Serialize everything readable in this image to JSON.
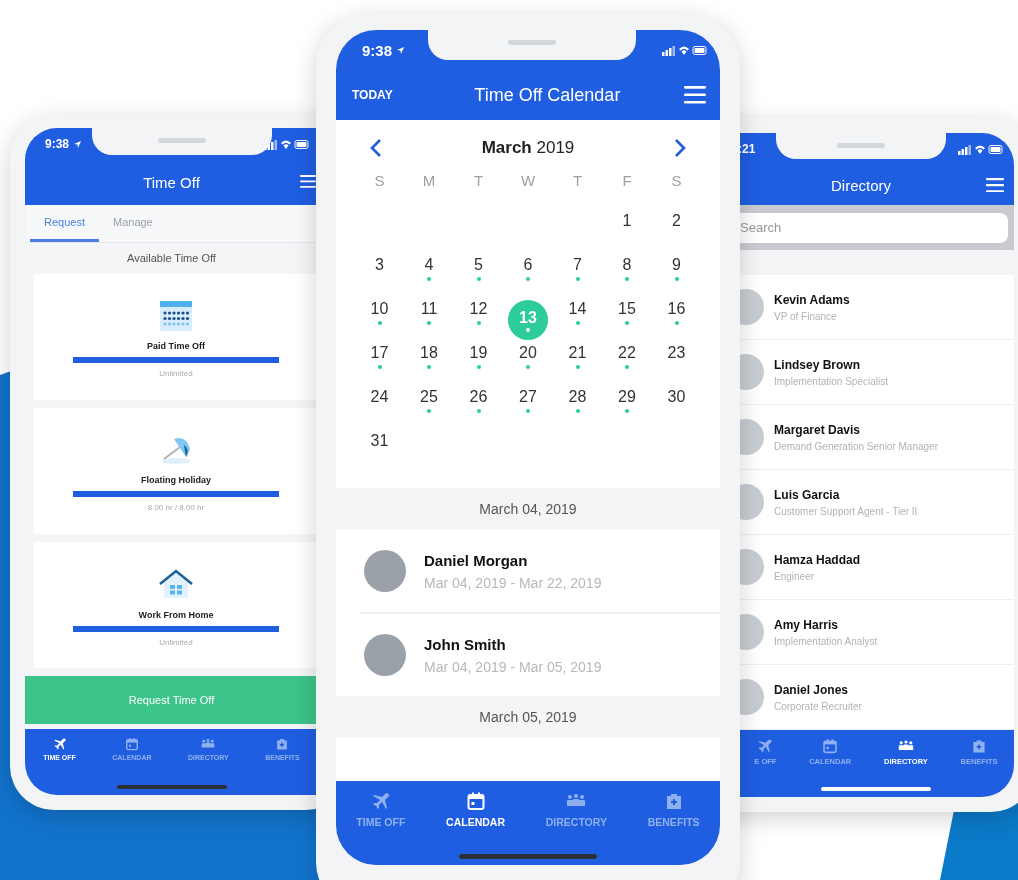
{
  "time_off_screen": {
    "status_time": "9:38",
    "title": "Time Off",
    "tabs": [
      {
        "label": "Request",
        "selected": true
      },
      {
        "label": "Manage",
        "selected": false
      }
    ],
    "section_title": "Available Time Off",
    "balances": [
      {
        "name": "Paid Time Off",
        "level": 1,
        "reading": "Unlimited"
      },
      {
        "name": "Floating Holiday",
        "level": 1,
        "reading": "8.00 hr / 8.00 hr"
      },
      {
        "name": "Work From Home",
        "level": 1,
        "reading": "Unlimited"
      }
    ],
    "action_button": "Request Time Off",
    "nav": [
      {
        "label": "TIME OFF",
        "selected": true
      },
      {
        "label": "CALENDAR",
        "selected": false
      },
      {
        "label": "DIRECTORY",
        "selected": false
      },
      {
        "label": "BENEFITS",
        "selected": false
      }
    ]
  },
  "calendar_screen": {
    "status_time": "9:38",
    "today_button": "TODAY",
    "title": "Time Off Calendar",
    "month_title": "**March** 2019",
    "weekdays": [
      "S",
      "M",
      "T",
      "W",
      "T",
      "F",
      "S"
    ],
    "weeks": [
      {
        "starts_mid_week": true,
        "days": [
          {
            "day": "1",
            "has_entries": false,
            "selected": false
          },
          {
            "day": "2",
            "has_entries": false,
            "selected": false
          }
        ]
      },
      {
        "days": [
          {
            "day": "3",
            "has_entries": false,
            "selected": false
          },
          {
            "day": "4",
            "has_entries": true,
            "selected": false
          },
          {
            "day": "5",
            "has_entries": true,
            "selected": false
          },
          {
            "day": "6",
            "has_entries": true,
            "selected": false
          },
          {
            "day": "7",
            "has_entries": true,
            "selected": false
          },
          {
            "day": "8",
            "has_entries": true,
            "selected": false
          },
          {
            "day": "9",
            "has_entries": true,
            "selected": false
          }
        ]
      },
      {
        "days": [
          {
            "day": "10",
            "has_entries": true,
            "selected": false
          },
          {
            "day": "11",
            "has_entries": true,
            "selected": false
          },
          {
            "day": "12",
            "has_entries": true,
            "selected": false
          },
          {
            "day": "13",
            "has_entries": true,
            "selected": true
          },
          {
            "day": "14",
            "has_entries": true,
            "selected": false
          },
          {
            "day": "15",
            "has_entries": true,
            "selected": false
          },
          {
            "day": "16",
            "has_entries": true,
            "selected": false
          }
        ]
      },
      {
        "days": [
          {
            "day": "17",
            "has_entries": true,
            "selected": false
          },
          {
            "day": "18",
            "has_entries": true,
            "selected": false
          },
          {
            "day": "19",
            "has_entries": true,
            "selected": false
          },
          {
            "day": "20",
            "has_entries": true,
            "selected": false
          },
          {
            "day": "21",
            "has_entries": true,
            "selected": false
          },
          {
            "day": "22",
            "has_entries": true,
            "selected": false
          },
          {
            "day": "23",
            "has_entries": false,
            "selected": false
          }
        ]
      },
      {
        "days": [
          {
            "day": "24",
            "has_entries": false,
            "selected": false
          },
          {
            "day": "25",
            "has_entries": true,
            "selected": false
          },
          {
            "day": "26",
            "has_entries": true,
            "selected": false
          },
          {
            "day": "27",
            "has_entries": true,
            "selected": false
          },
          {
            "day": "28",
            "has_entries": true,
            "selected": false
          },
          {
            "day": "29",
            "has_entries": true,
            "selected": false
          },
          {
            "day": "30",
            "has_entries": false,
            "selected": false
          }
        ]
      },
      {
        "days": [
          {
            "day": "31",
            "has_entries": false,
            "selected": false
          }
        ]
      }
    ],
    "agenda": [
      {
        "date": "March 04, 2019",
        "entries": [
          {
            "name": "Daniel Morgan",
            "dates": "Mar 04, 2019 - Mar 22, 2019"
          },
          {
            "name": "John Smith",
            "dates": "Mar 04, 2019 - Mar 05, 2019"
          }
        ]
      },
      {
        "date": "March 05, 2019"
      }
    ],
    "nav": [
      {
        "label": "TIME OFF",
        "selected": false
      },
      {
        "label": "CALENDAR",
        "selected": true
      },
      {
        "label": "DIRECTORY",
        "selected": false
      },
      {
        "label": "BENEFITS",
        "selected": false
      }
    ]
  },
  "directory_screen": {
    "status_time": ":21",
    "title": "Directory",
    "search": {
      "placeholder": "Search"
    },
    "people": [
      {
        "name": "Kevin Adams",
        "role": "VP of Finance"
      },
      {
        "name": "Lindsey Brown",
        "role": "Implementation Specialist"
      },
      {
        "name": "Margaret Davis",
        "role": "Demand Generation Senior Manager"
      },
      {
        "name": "Luis Garcia",
        "role": "Customer Support Agent - Tier II"
      },
      {
        "name": "Hamza Haddad",
        "role": "Engineer"
      },
      {
        "name": "Amy Harris",
        "role": "Implementation Analyst"
      },
      {
        "name": "Daniel Jones",
        "role": "Corporate Recruiter"
      }
    ],
    "nav": [
      {
        "label": "E OFF",
        "selected": false
      },
      {
        "label": "CALENDAR",
        "selected": false
      },
      {
        "label": "DIRECTORY",
        "selected": true
      },
      {
        "label": "BENEFITS",
        "selected": false
      }
    ]
  }
}
